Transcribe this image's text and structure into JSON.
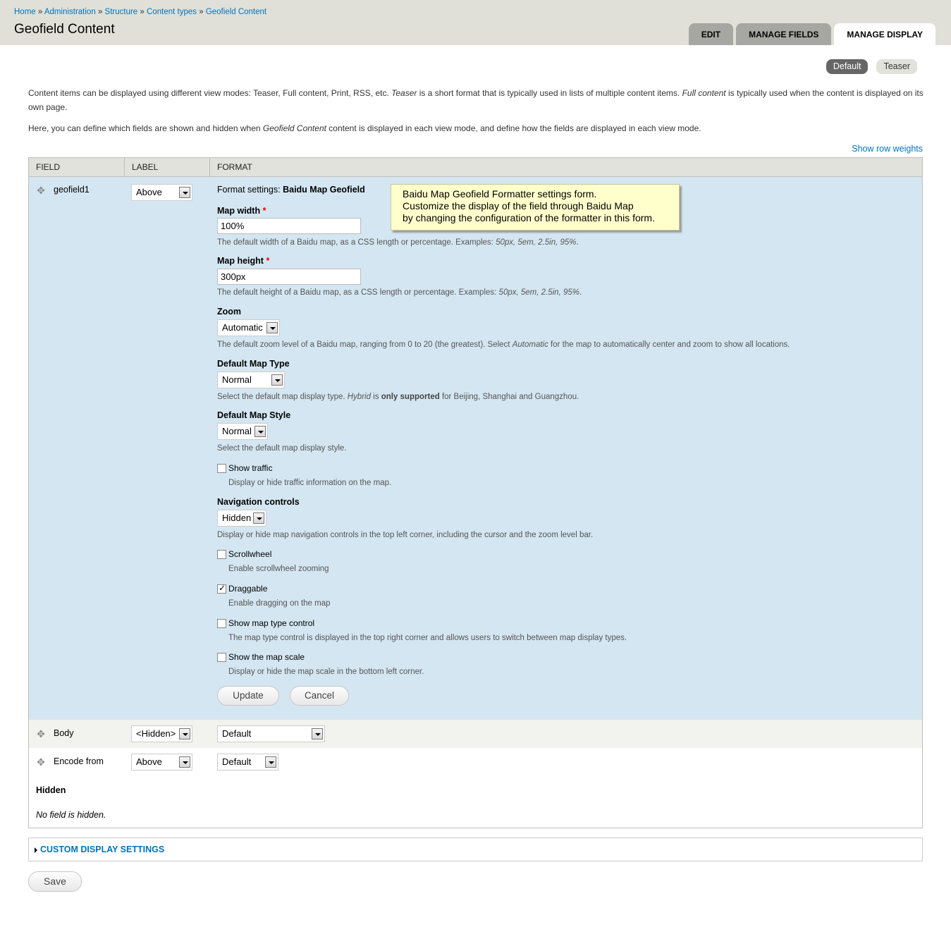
{
  "breadcrumb": {
    "items": [
      "Home",
      "Administration",
      "Structure",
      "Content types",
      "Geofield Content"
    ],
    "separator": "»"
  },
  "page_title": "Geofield Content",
  "tabs": [
    {
      "label": "EDIT",
      "active": false
    },
    {
      "label": "MANAGE FIELDS",
      "active": false
    },
    {
      "label": "MANAGE DISPLAY",
      "active": true
    }
  ],
  "view_modes": [
    {
      "label": "Default",
      "active": true
    },
    {
      "label": "Teaser",
      "active": false
    }
  ],
  "intro": {
    "p1_a": "Content items can be displayed using different view modes: Teaser, Full content, Print, RSS, etc. ",
    "p1_em1": "Teaser",
    "p1_b": " is a short format that is typically used in lists of multiple content items. ",
    "p1_em2": "Full content",
    "p1_c": " is typically used when the content is displayed on its own page.",
    "p2_a": "Here, you can define which fields are shown and hidden when ",
    "p2_em": "Geofield Content",
    "p2_b": " content is displayed in each view mode, and define how the fields are displayed in each view mode."
  },
  "show_row_weights": "Show row weights",
  "table": {
    "headers": [
      "FIELD",
      "LABEL",
      "FORMAT"
    ],
    "editing_row": {
      "field": "geofield1",
      "label_select": "Above",
      "format_settings_prefix": "Format settings: ",
      "format_settings_name": "Baidu Map Geofield",
      "map_width": {
        "label": "Map width",
        "required": "*",
        "value": "100%",
        "desc_a": "The default width of a Baidu map, as a CSS length or percentage. Examples: ",
        "desc_em": "50px, 5em, 2.5in, 95%"
      },
      "map_height": {
        "label": "Map height",
        "required": "*",
        "value": "300px",
        "desc_a": "The default height of a Baidu map, as a CSS length or percentage. Examples: ",
        "desc_em": "50px, 5em, 2.5in, 95%"
      },
      "zoom": {
        "label": "Zoom",
        "value": "Automatic",
        "desc_a": "The default zoom level of a Baidu map, ranging from 0 to 20 (the greatest). Select ",
        "desc_em": "Automatic",
        "desc_b": " for the map to automatically center and zoom to show all locations."
      },
      "map_type": {
        "label": "Default Map Type",
        "value": "Normal",
        "desc_a": "Select the default map display type. ",
        "desc_em": "Hybrid",
        "desc_b": " is ",
        "desc_strong": "only supported",
        "desc_c": " for Beijing, Shanghai and Guangzhou."
      },
      "map_style": {
        "label": "Default Map Style",
        "value": "Normal",
        "desc": "Select the default map display style."
      },
      "show_traffic": {
        "label": "Show traffic",
        "checked": false,
        "desc": "Display or hide traffic information on the map."
      },
      "navigation": {
        "label": "Navigation controls",
        "value": "Hidden",
        "desc": "Display or hide map navigation controls in the top left corner, including the cursor and the zoom level bar."
      },
      "scrollwheel": {
        "label": "Scrollwheel",
        "checked": false,
        "desc": "Enable scrollwheel zooming"
      },
      "draggable": {
        "label": "Draggable",
        "checked": true,
        "desc": "Enable dragging on the map"
      },
      "map_type_control": {
        "label": "Show map type control",
        "checked": false,
        "desc": "The map type control is displayed in the top right corner and allows users to switch between map display types."
      },
      "map_scale": {
        "label": "Show the map scale",
        "checked": false,
        "desc": "Display or hide the map scale in the bottom left corner."
      },
      "update_button": "Update",
      "cancel_button": "Cancel"
    },
    "rows": [
      {
        "field": "Body",
        "label_select": "<Hidden>",
        "format_select": "Default"
      },
      {
        "field": "Encode from",
        "label_select": "Above",
        "format_select": "Default"
      }
    ],
    "hidden_title": "Hidden",
    "no_hidden": "No field is hidden."
  },
  "tooltip": {
    "line1": "Baidu Map Geofield Formatter settings form.",
    "line2": "Customize the display of the field through Baidu Map",
    "line3": "by changing the configuration of the formatter in this form."
  },
  "custom_display_settings": "CUSTOM DISPLAY SETTINGS",
  "save_button": "Save",
  "colors": {
    "header_bg": "#e0e0d8",
    "link": "#0074bd",
    "edit_row_bg": "#d4e6f1",
    "tooltip_bg": "#ffffcc"
  }
}
